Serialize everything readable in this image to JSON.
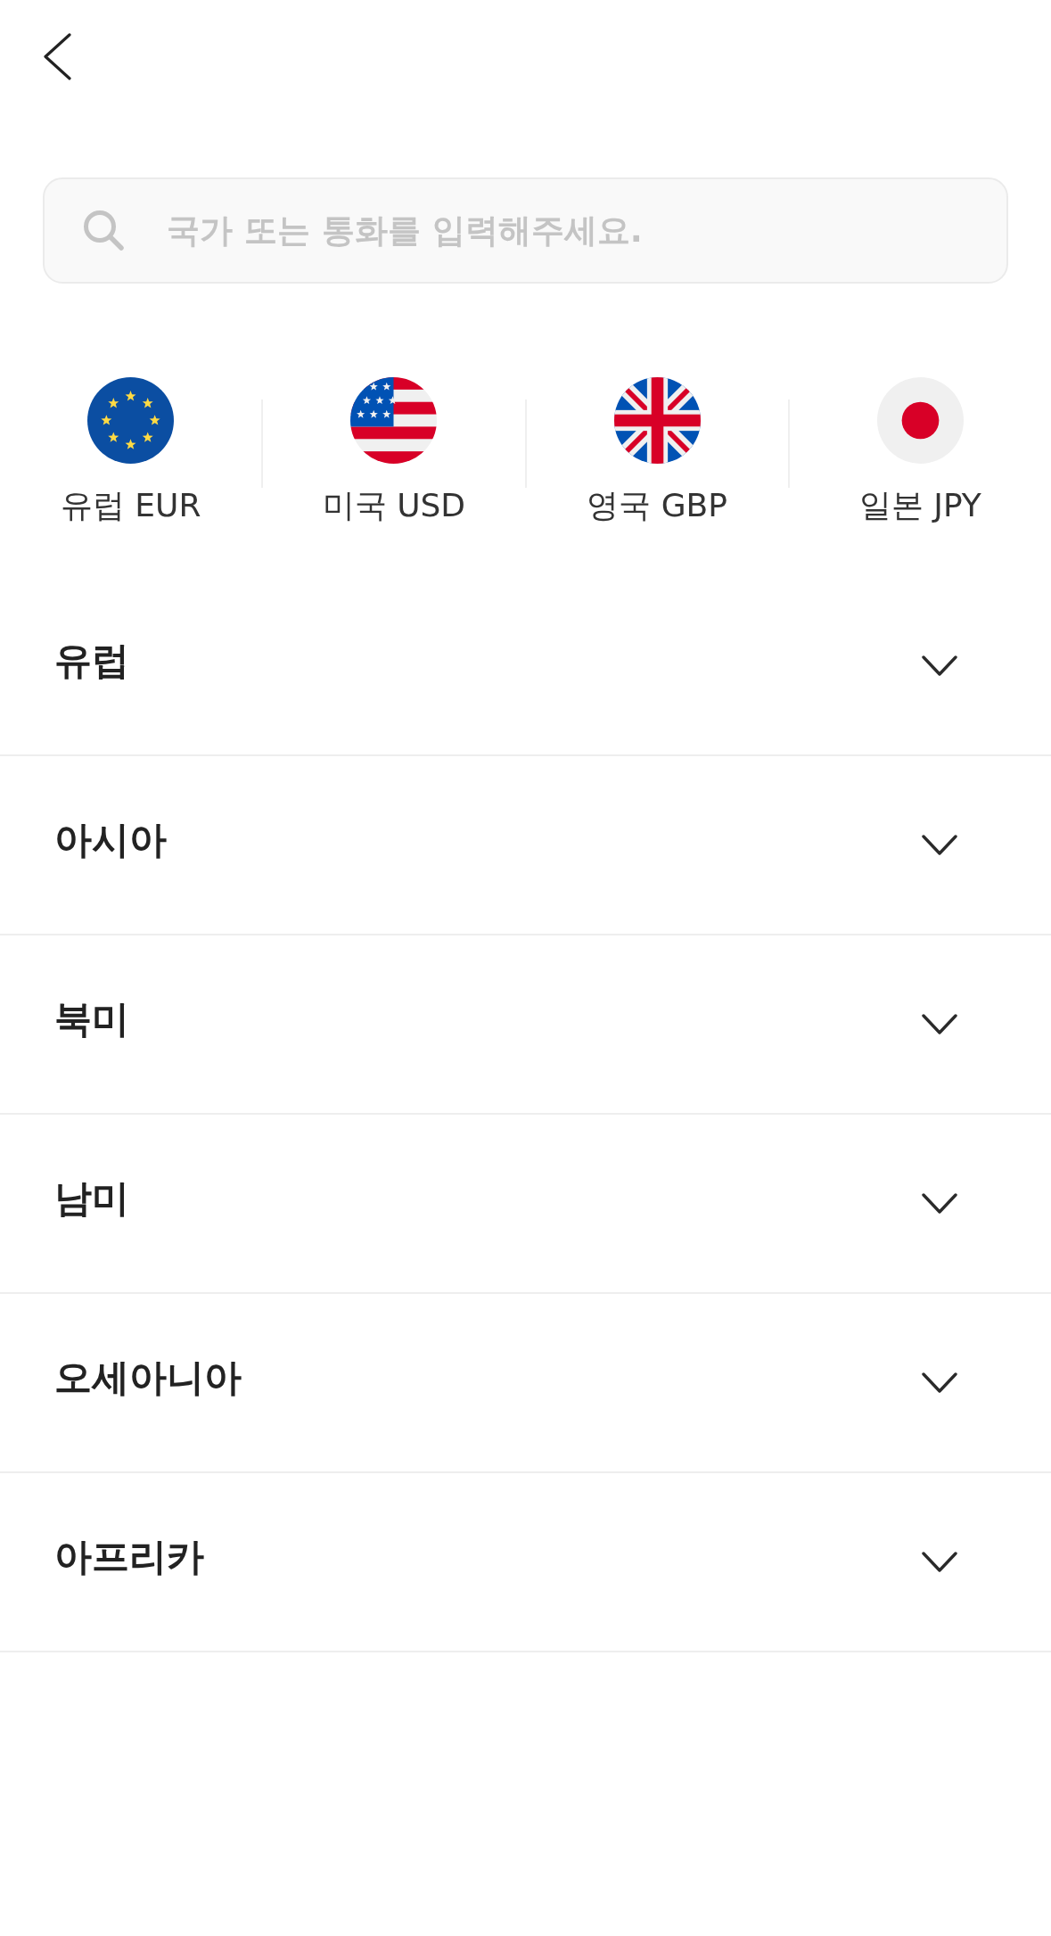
{
  "search": {
    "placeholder": "국가 또는 통화를 입력해주세요."
  },
  "quick_currencies": [
    {
      "label": "유럽 EUR"
    },
    {
      "label": "미국 USD"
    },
    {
      "label": "영국 GBP"
    },
    {
      "label": "일본 JPY"
    }
  ],
  "regions": [
    {
      "label": "유럽",
      "expanded": false
    },
    {
      "label": "아시아",
      "expanded": false
    },
    {
      "label": "북미",
      "expanded": false
    },
    {
      "label": "남미",
      "expanded": false
    },
    {
      "label": "오세아니아",
      "expanded": false
    },
    {
      "label": "아프리카",
      "expanded": false
    }
  ]
}
